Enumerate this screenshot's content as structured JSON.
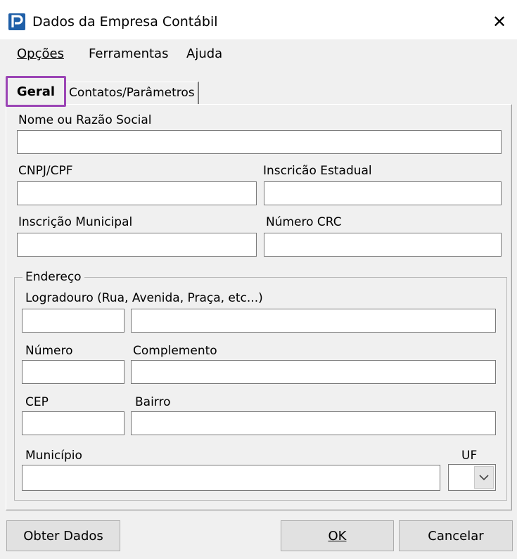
{
  "window": {
    "title": "Dados da Empresa Contábil",
    "app_icon": "app-logo-p-icon",
    "close_glyph": "✕"
  },
  "menu": {
    "opcoes": "Opções",
    "ferramentas": "Ferramentas",
    "ajuda": "Ajuda"
  },
  "tabs": {
    "geral": "Geral",
    "contatos": "Contatos/Parâmetros"
  },
  "form": {
    "nome_label": "Nome ou Razão Social",
    "nome_value": "",
    "cnpj_label": "CNPJ/CPF",
    "cnpj_value": "",
    "ie_label": "Inscricão Estadual",
    "ie_value": "",
    "im_label": "Inscrição Municipal",
    "im_value": "",
    "crc_label": "Número CRC",
    "crc_value": ""
  },
  "endereco": {
    "legend": "Endereço",
    "logradouro_label": "Logradouro (Rua, Avenida, Praça, etc...)",
    "tipo_value": "",
    "logradouro_value": "",
    "numero_label": "Número",
    "numero_value": "",
    "complemento_label": "Complemento",
    "complemento_value": "",
    "cep_label": "CEP",
    "cep_value": "",
    "bairro_label": "Bairro",
    "bairro_value": "",
    "municipio_label": "Município",
    "municipio_value": "",
    "uf_label": "UF",
    "uf_value": ""
  },
  "buttons": {
    "obter_dados": "Obter Dados",
    "ok": "OK",
    "cancelar": "Cancelar"
  },
  "colors": {
    "tab_highlight": "#9b45b5",
    "app_icon": "#1f5fa8"
  }
}
